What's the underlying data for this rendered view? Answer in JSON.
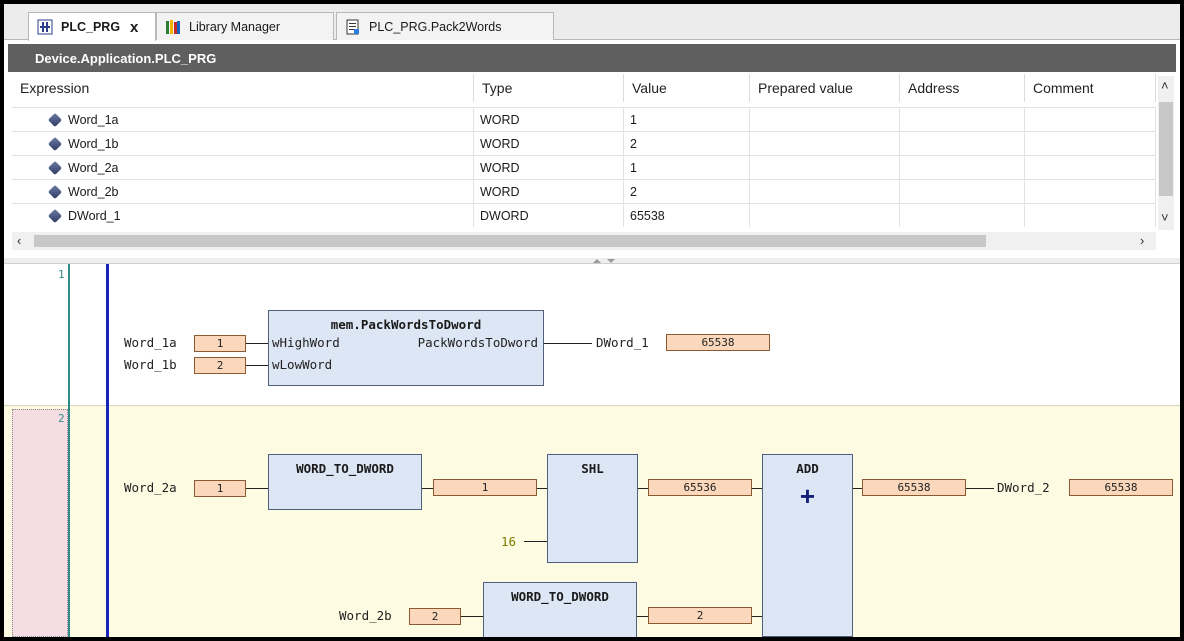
{
  "tabs": [
    {
      "label": "PLC_PRG",
      "icon": "pou-icon",
      "active": true,
      "close": "x"
    },
    {
      "label": "Library Manager",
      "icon": "library-books-icon",
      "active": false
    },
    {
      "label": "PLC_PRG.Pack2Words",
      "icon": "document-icon",
      "active": false
    }
  ],
  "title": "Device.Application.PLC_PRG",
  "watch": {
    "columns": [
      "Expression",
      "Type",
      "Value",
      "Prepared value",
      "Address",
      "Comment"
    ],
    "rows": [
      {
        "expression": "Word_1a",
        "type": "WORD",
        "value": "1"
      },
      {
        "expression": "Word_1b",
        "type": "WORD",
        "value": "2"
      },
      {
        "expression": "Word_2a",
        "type": "WORD",
        "value": "1"
      },
      {
        "expression": "Word_2b",
        "type": "WORD",
        "value": "2"
      },
      {
        "expression": "DWord_1",
        "type": "DWORD",
        "value": "65538"
      }
    ]
  },
  "network1": {
    "number": "1",
    "fb_name": "mem.PackWordsToDword",
    "in1_label": "Word_1a",
    "in1_value": "1",
    "pin1": "wHighWord",
    "in2_label": "Word_1b",
    "in2_value": "2",
    "pin2": "wLowWord",
    "out_pin": "PackWordsToDword",
    "out_label": "DWord_1",
    "out_value": "65538"
  },
  "network2": {
    "number": "2",
    "in_a_label": "Word_2a",
    "in_a_value": "1",
    "conv1": "WORD_TO_DWORD",
    "conv1_out": "1",
    "shl": "SHL",
    "shift_const": "16",
    "shl_out": "65536",
    "in_b_label": "Word_2b",
    "in_b_value": "2",
    "conv2": "WORD_TO_DWORD",
    "conv2_out": "2",
    "add": "ADD",
    "add_symbol": "+",
    "add_out": "65538",
    "out_label": "DWord_2",
    "out_value": "65538"
  }
}
